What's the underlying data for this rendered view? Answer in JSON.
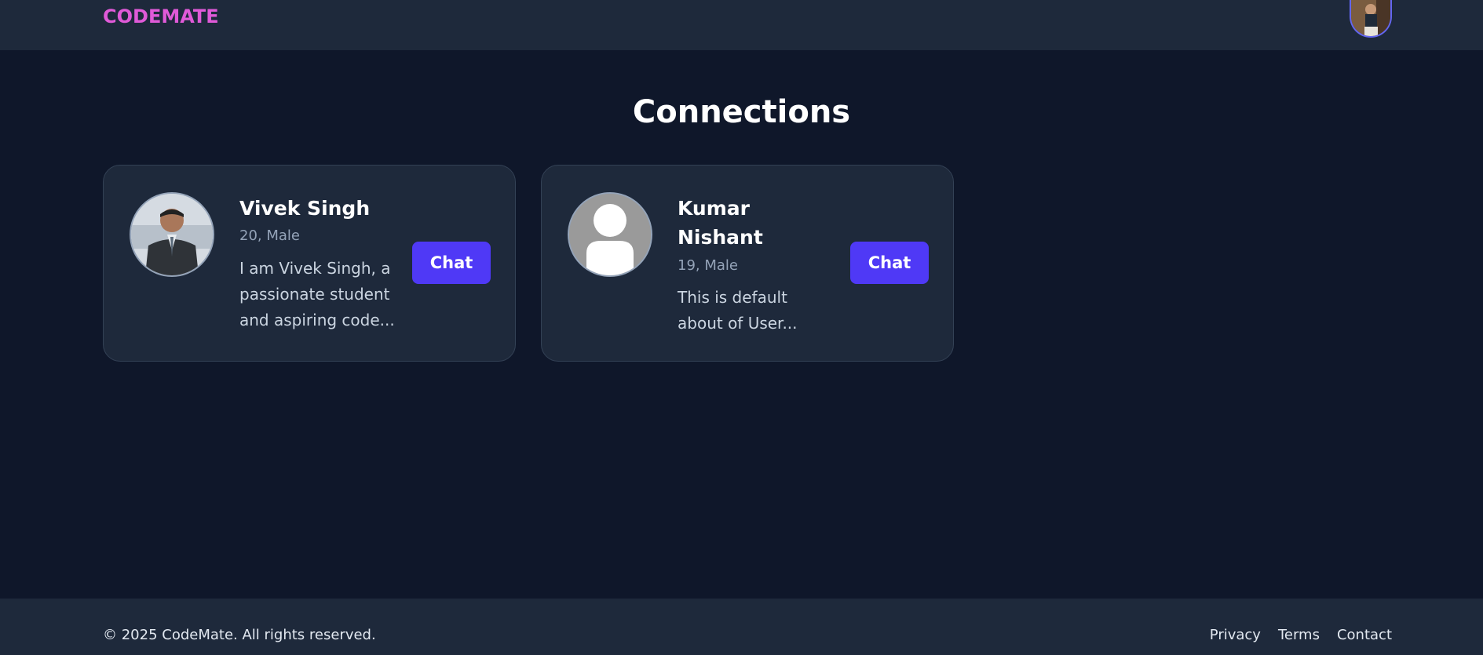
{
  "navbar": {
    "brand": "CODEMATE",
    "user_avatar_icon": "user-photo-avatar"
  },
  "page": {
    "title": "Connections"
  },
  "connections": [
    {
      "name": "Vivek Singh",
      "meta": "20, Male",
      "about": "I am Vivek Singh, a passionate student and aspiring code...",
      "avatar": "user-photo-avatar",
      "chat_label": "Chat"
    },
    {
      "name": "Kumar Nishant",
      "meta": "19, Male",
      "about": "This is default about of User...",
      "avatar": "default-user-icon",
      "chat_label": "Chat"
    }
  ],
  "footer": {
    "copyright": "© 2025 CodeMate. All rights reserved.",
    "links": [
      "Privacy",
      "Terms",
      "Contact"
    ]
  },
  "colors": {
    "background": "#0f172a",
    "surface": "#1e293b",
    "brand": "#e05ad8",
    "accent": "#4f39f6"
  }
}
